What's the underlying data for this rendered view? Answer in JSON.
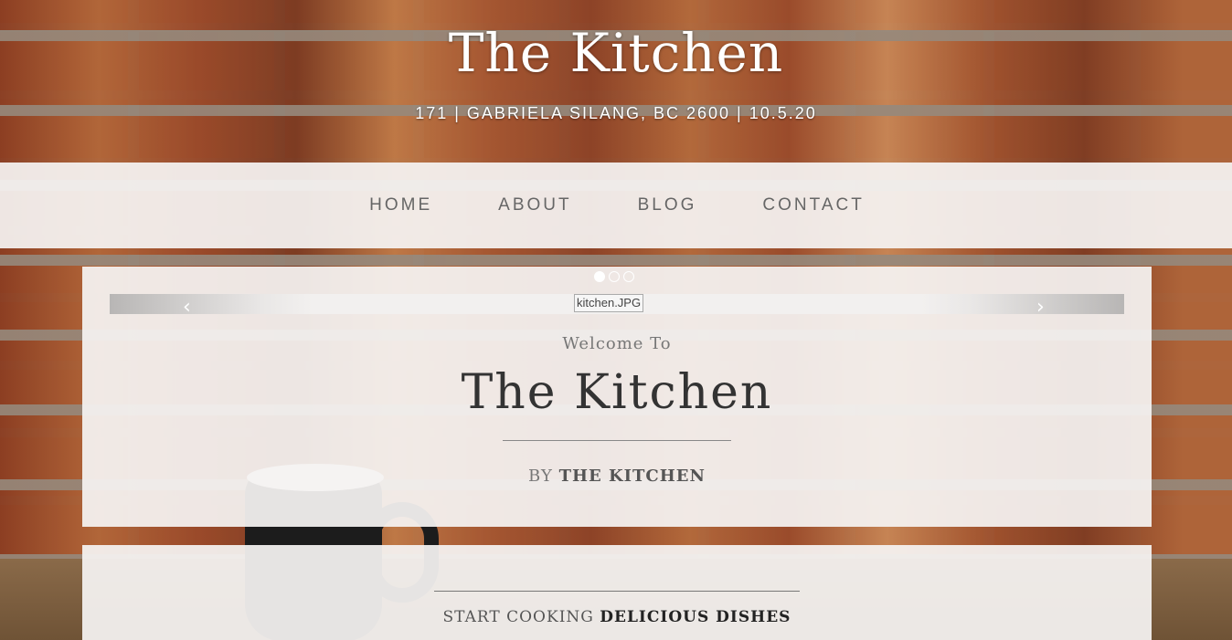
{
  "header": {
    "title": "The Kitchen",
    "address": "171 | GABRIELA SILANG, BC 2600 | 10.5.20"
  },
  "nav": {
    "items": [
      {
        "label": "HOME"
      },
      {
        "label": "ABOUT"
      },
      {
        "label": "BLOG"
      },
      {
        "label": "CONTACT"
      }
    ]
  },
  "carousel": {
    "image_alt": "kitchen.JPG",
    "prev_glyph": "‹",
    "next_glyph": "›",
    "indicator_count": 3,
    "active_index": 0
  },
  "hero": {
    "welcome": "Welcome To",
    "title": "The Kitchen",
    "byline_prefix": "BY",
    "byline_name": "THE KITCHEN"
  },
  "section": {
    "heading_prefix": "START COOKING",
    "heading_emphasis": "DELICIOUS DISHES"
  }
}
